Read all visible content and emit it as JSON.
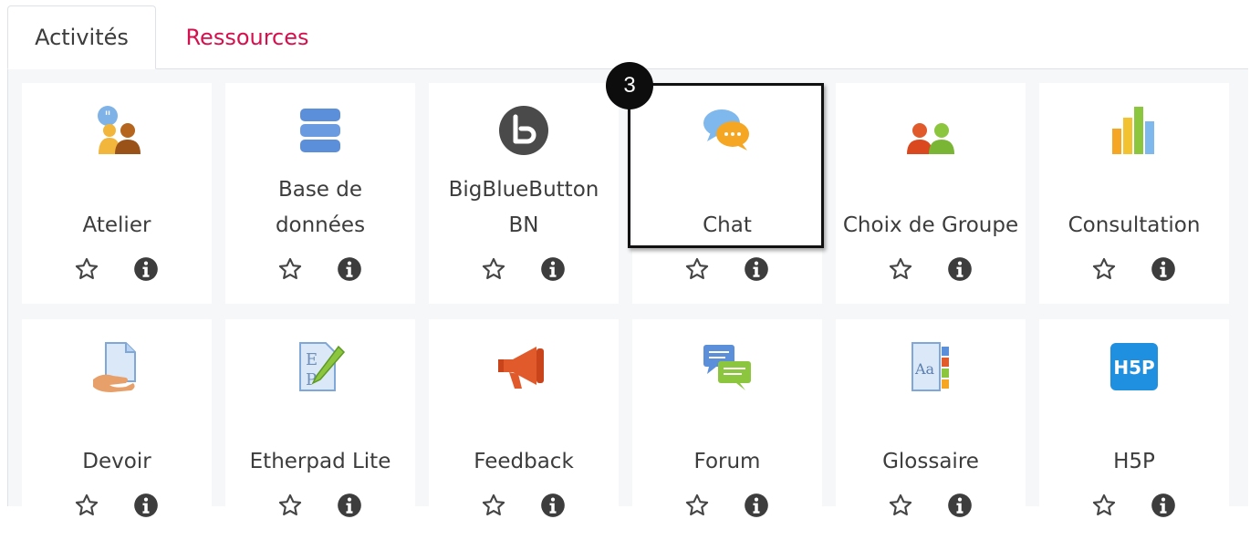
{
  "tabs": [
    {
      "label": "Activités",
      "active": true
    },
    {
      "label": "Ressources",
      "active": false
    }
  ],
  "annotation": {
    "step": "3",
    "target": "Chat"
  },
  "colors": {
    "tab_inactive": "#d6104e",
    "text": "#3c3c3c",
    "panel_bg": "#f6f7f9",
    "icon_dark": "#4a4a4a"
  },
  "modules": [
    {
      "label": "Atelier",
      "icon": "workshop-icon"
    },
    {
      "label": "Base de données",
      "icon": "database-icon"
    },
    {
      "label": "BigBlueButton BN",
      "icon": "bigbluebutton-icon"
    },
    {
      "label": "Chat",
      "icon": "chat-icon"
    },
    {
      "label": "Choix de Groupe",
      "icon": "group-choice-icon"
    },
    {
      "label": "Consultation",
      "icon": "survey-chart-icon"
    },
    {
      "label": "Devoir",
      "icon": "assignment-icon"
    },
    {
      "label": "Etherpad Lite",
      "icon": "etherpad-icon"
    },
    {
      "label": "Feedback",
      "icon": "megaphone-icon"
    },
    {
      "label": "Forum",
      "icon": "forum-icon"
    },
    {
      "label": "Glossaire",
      "icon": "glossary-icon"
    },
    {
      "label": "H5P",
      "icon": "h5p-icon"
    }
  ]
}
